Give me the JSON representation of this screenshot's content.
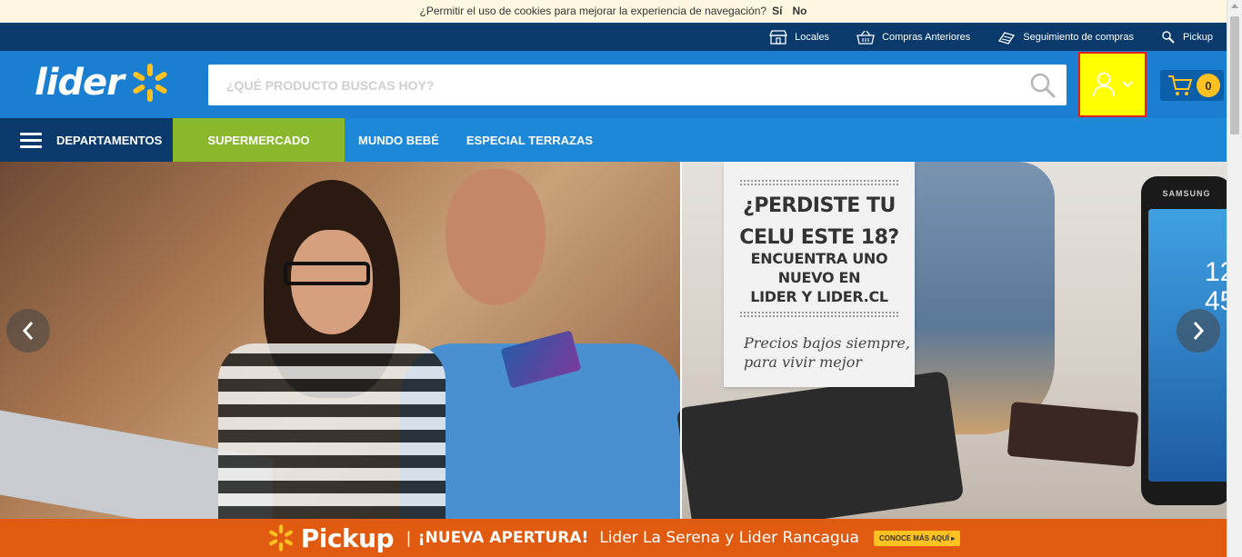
{
  "cookie_bar": {
    "message": "¿Permitir el uso de cookies para mejorar la experiencia de navegación?",
    "accept_label": "Sí",
    "decline_label": "No"
  },
  "utility_bar": {
    "items": [
      {
        "label": "Locales",
        "icon": "store-icon"
      },
      {
        "label": "Compras Anteriores",
        "icon": "basket-icon"
      },
      {
        "label": "Seguimiento de compras",
        "icon": "tracking-icon"
      },
      {
        "label": "Pickup",
        "icon": "pickup-icon"
      }
    ]
  },
  "header": {
    "logo_text": "lider",
    "search_placeholder": "¿QUÉ PRODUCTO BUSCAS HOY?",
    "cart_count": "0"
  },
  "nav": {
    "departments_label": "DEPARTAMENTOS",
    "supermarket_label": "SUPERMERCADO",
    "links": [
      "MUNDO BEBÉ",
      "ESPECIAL TERRAZAS"
    ]
  },
  "hero": {
    "promo_title_1": "¿PERDISTE TU",
    "promo_title_2": "CELU ESTE 18?",
    "promo_sub_1": "ENCUENTRA UNO",
    "promo_sub_2": "NUEVO EN",
    "promo_sub_3": "LIDER Y LIDER.CL",
    "promo_tag_1": "Precios bajos siempre,",
    "promo_tag_2": "para vivir mejor",
    "phone_brand": "SAMSUNG",
    "phone_time_1": "12",
    "phone_time_2": "45"
  },
  "pickup_band": {
    "brand": "Pickup",
    "separator": "|",
    "headline": "¡NUEVA APERTURA!",
    "stores": "Lider La Serena y Lider Rancagua",
    "cta_label": "CONOCE MÁS AQUÍ ▸"
  },
  "colors": {
    "brand_blue": "#1a7fd0",
    "dark_blue": "#0a3a6b",
    "spark_yellow": "#ffc220",
    "green": "#8ab82c",
    "orange": "#e05a10",
    "highlight_yellow": "#ffff00"
  }
}
